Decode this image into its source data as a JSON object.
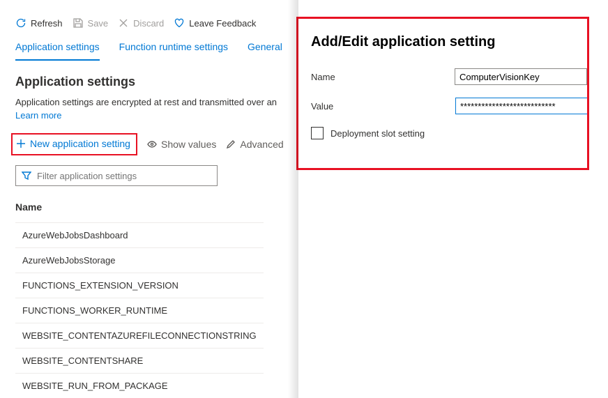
{
  "toolbar": {
    "refresh": "Refresh",
    "save": "Save",
    "discard": "Discard",
    "feedback": "Leave Feedback"
  },
  "tabs": {
    "app_settings": "Application settings",
    "runtime": "Function runtime settings",
    "general": "General"
  },
  "section": {
    "title": "Application settings",
    "description": "Application settings are encrypted at rest and transmitted over an",
    "learn_more": "Learn more"
  },
  "actions": {
    "new_setting": "New application setting",
    "show_values": "Show values",
    "advanced": "Advanced"
  },
  "filter": {
    "placeholder": "Filter application settings"
  },
  "table": {
    "header": "Name",
    "rows": [
      "AzureWebJobsDashboard",
      "AzureWebJobsStorage",
      "FUNCTIONS_EXTENSION_VERSION",
      "FUNCTIONS_WORKER_RUNTIME",
      "WEBSITE_CONTENTAZUREFILECONNECTIONSTRING",
      "WEBSITE_CONTENTSHARE",
      "WEBSITE_RUN_FROM_PACKAGE"
    ]
  },
  "panel": {
    "title": "Add/Edit application setting",
    "name_label": "Name",
    "name_value": "ComputerVisionKey",
    "value_label": "Value",
    "value_value": "***************************",
    "slot_label": "Deployment slot setting"
  }
}
